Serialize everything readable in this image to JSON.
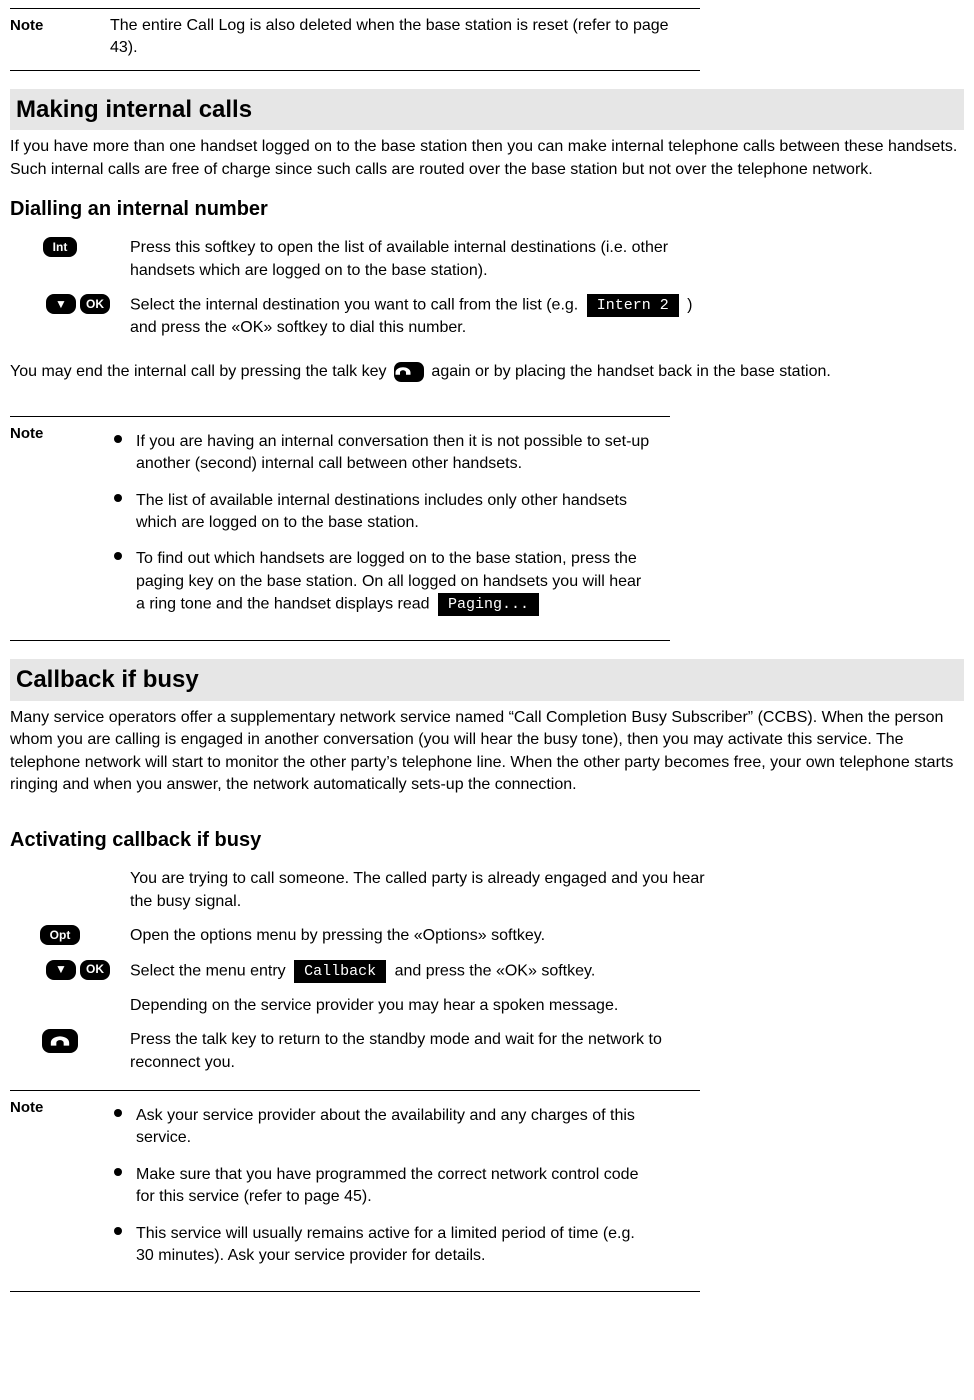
{
  "topNote": {
    "label": "Note",
    "text": "The entire Call Log is also deleted when the base station is reset (refer to page 43)."
  },
  "section1": {
    "heading": "Making internal calls",
    "intro": "If you have more than one handset logged on to the base station then you can make internal telephone calls between these handsets. Such internal calls are free of charge since such calls are routed over the base station but not over the telephone network.",
    "sub": "Dialling an internal number",
    "softkeys": {
      "int": "Int",
      "ok": "OK",
      "down": "▼"
    },
    "step1": "Press this softkey to open the list of available internal destinations (i.e. other handsets which are logged on to the base station).",
    "step2a": "Select the internal destination you want to call from the list (e.g.",
    "step2_tag": "Intern 2",
    "step2b": ") and press the «OK» softkey to dial this number.",
    "endcall_a": "You may end the internal call by pressing the talk key",
    "endcall_b": "again or by placing the handset back in the base station."
  },
  "note2": {
    "label": "Note",
    "items": [
      "If you are having an internal conversation then it is not possible to set-up another (second) internal call between other handsets.",
      "The list of available internal destinations includes only other handsets which are logged on to the base station."
    ],
    "item3a": "To find out which handsets are logged on to the base station, press the paging key on the base station. On all logged on handsets you will hear a ring tone and the handset displays read",
    "item3_tag": "Paging..."
  },
  "section2": {
    "heading": "Callback if busy",
    "intro": "Many service operators offer a supplementary network service named “Call Completion Busy Subscriber” (CCBS). When the person whom you are calling is engaged in another conversation (you will hear the busy tone), then you may activate this service. The telephone network will start to monitor the other party’s telephone line. When the other party becomes free, your own telephone starts ringing and when you answer, the network automatically sets-up the connection.",
    "sub": "Activating callback if busy",
    "softkeys": {
      "opt": "Opt",
      "ok": "OK",
      "down": "▼"
    },
    "pre": "You are trying to call someone. The called party is already engaged and you hear the busy signal.",
    "step1": "Open the options menu by pressing the «Options» softkey.",
    "step2a": "Select the menu entry",
    "step2_tag": "Callback",
    "step2b": "and press the «OK» softkey.",
    "step3": "Depending on the service provider you may hear a spoken message.",
    "step4": "Press the talk key to return to the standby mode and wait for the network to reconnect you."
  },
  "note3": {
    "label": "Note",
    "items": [
      "Ask your service provider about the availability and any charges of this service.",
      "Make sure that you have programmed the correct network control code for this service (refer to page 45).",
      "This service will usually remains active for a limited period of time (e.g. 30 minutes). Ask your service provider for details."
    ]
  }
}
